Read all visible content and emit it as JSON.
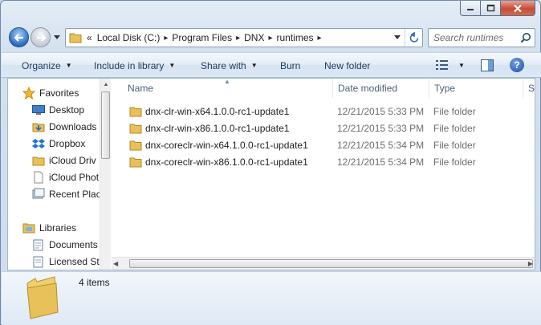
{
  "window": {
    "minimize_icon": "minimize-icon",
    "maximize_icon": "maximize-icon",
    "close_icon": "close-icon"
  },
  "navigation": {
    "back_icon": "back-arrow-icon",
    "forward_icon": "forward-arrow-icon",
    "breadcrumb_overflow": "«",
    "breadcrumbs": [
      "Local Disk (C:)",
      "Program Files",
      "DNX",
      "runtimes"
    ],
    "search_placeholder": "Search runtimes"
  },
  "toolbar": {
    "organize": "Organize",
    "include_in_library": "Include in library",
    "share_with": "Share with",
    "burn": "Burn",
    "new_folder": "New folder",
    "help": "?"
  },
  "sidebar": {
    "favorites_label": "Favorites",
    "favorites": [
      {
        "label": "Desktop",
        "icon": "desktop-icon"
      },
      {
        "label": "Downloads",
        "icon": "downloads-icon"
      },
      {
        "label": "Dropbox",
        "icon": "dropbox-icon"
      },
      {
        "label": "iCloud Driv",
        "icon": "icloud-drive-icon"
      },
      {
        "label": "iCloud Phot",
        "icon": "icloud-photos-icon"
      },
      {
        "label": "Recent Plac",
        "icon": "recent-places-icon"
      }
    ],
    "libraries_label": "Libraries",
    "libraries": [
      {
        "label": "Documents",
        "icon": "documents-icon"
      },
      {
        "label": "Licensed St",
        "icon": "library-icon"
      }
    ]
  },
  "columns": {
    "name": "Name",
    "date_modified": "Date modified",
    "type": "Type",
    "size": "Si"
  },
  "files": [
    {
      "name": "dnx-clr-win-x64.1.0.0-rc1-update1",
      "date": "12/21/2015 5:33 PM",
      "type": "File folder"
    },
    {
      "name": "dnx-clr-win-x86.1.0.0-rc1-update1",
      "date": "12/21/2015 5:33 PM",
      "type": "File folder"
    },
    {
      "name": "dnx-coreclr-win-x64.1.0.0-rc1-update1",
      "date": "12/21/2015 5:34 PM",
      "type": "File folder"
    },
    {
      "name": "dnx-coreclr-win-x86.1.0.0-rc1-update1",
      "date": "12/21/2015 5:34 PM",
      "type": "File folder"
    }
  ],
  "status": {
    "item_count": "4 items"
  },
  "colors": {
    "folder": "#e8c15a",
    "link_text": "#1e3a5f",
    "header_text": "#4c607a"
  }
}
